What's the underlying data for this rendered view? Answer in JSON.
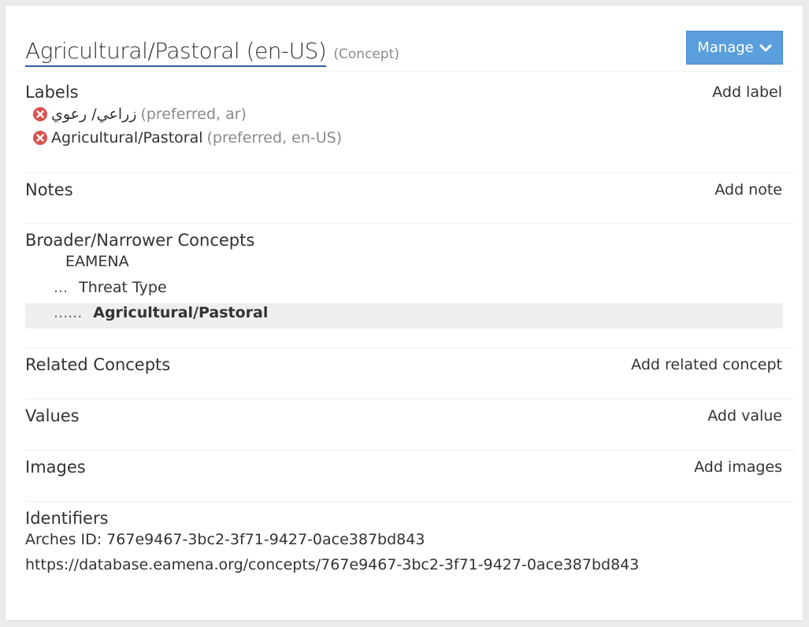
{
  "header": {
    "title": "Agricultural/Pastoral (en-US)",
    "type": "(Concept)",
    "manage_label": "Manage",
    "accent_color": "#2f5d9e",
    "button_color": "#5a9fdc"
  },
  "labels": {
    "heading": "Labels",
    "action": "Add label",
    "items": [
      {
        "text": "زراعي/ رعوي",
        "meta": "(preferred, ar)"
      },
      {
        "text": "Agricultural/Pastoral",
        "meta": "(preferred, en-US)"
      }
    ]
  },
  "notes": {
    "heading": "Notes",
    "action": "Add note"
  },
  "broader": {
    "heading": "Broader/Narrower Concepts",
    "items": [
      {
        "dots": "",
        "text": "EAMENA"
      },
      {
        "dots": "...",
        "text": "Threat Type"
      },
      {
        "dots": "......",
        "text": "Agricultural/Pastoral"
      }
    ]
  },
  "related": {
    "heading": "Related Concepts",
    "action": "Add related concept"
  },
  "values": {
    "heading": "Values",
    "action": "Add value"
  },
  "images": {
    "heading": "Images",
    "action": "Add images"
  },
  "identifiers": {
    "heading": "Identifiers",
    "arches_id": "Arches ID: 767e9467-3bc2-3f71-9427-0ace387bd843",
    "url": "https://database.eamena.org/concepts/767e9467-3bc2-3f71-9427-0ace387bd843"
  }
}
